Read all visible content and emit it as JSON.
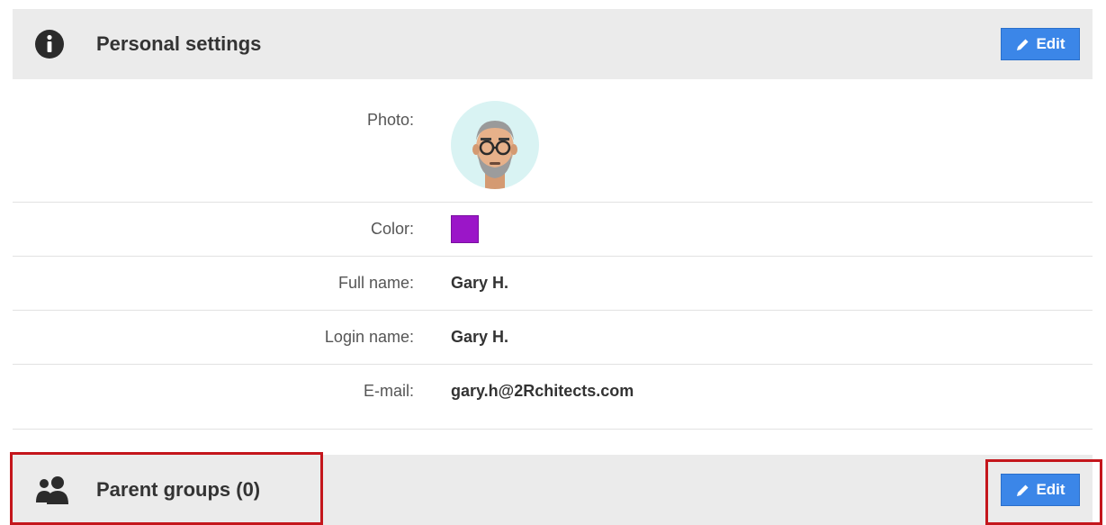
{
  "personal": {
    "title": "Personal settings",
    "icon": "info-circle-icon",
    "edit_label": "Edit"
  },
  "fields": {
    "photo_label": "Photo:",
    "color_label": "Color:",
    "color_value": "#9b16c8",
    "fullname_label": "Full name:",
    "fullname_value": "Gary H.",
    "login_label": "Login name:",
    "login_value": "Gary H.",
    "email_label": "E-mail:",
    "email_value": "gary.h@2Rchitects.com"
  },
  "groups": {
    "title": "Parent groups (0)",
    "icon": "users-icon",
    "edit_label": "Edit"
  },
  "colors": {
    "accent": "#3b86e8",
    "highlight": "#c4161c",
    "header_bg": "#ebebeb"
  }
}
